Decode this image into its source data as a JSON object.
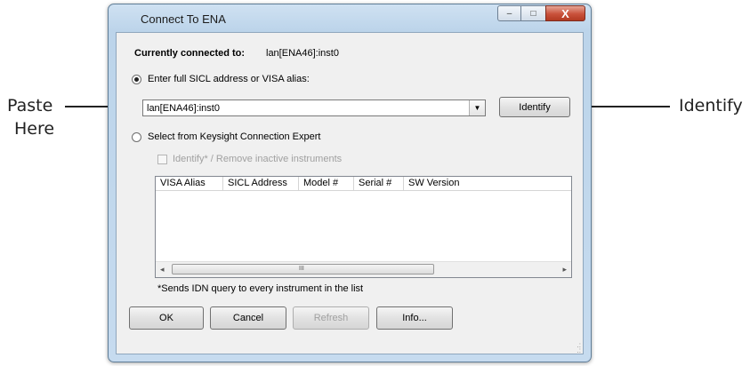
{
  "callouts": {
    "left_line1": "Paste",
    "left_line2": "Here",
    "right": "Identify"
  },
  "window": {
    "title": "Connect To ENA",
    "controls": {
      "minimize": "–",
      "maximize": "□",
      "close": "X"
    }
  },
  "dialog": {
    "connected_label": "Currently connected to:",
    "connected_value": "lan[ENA46]:inst0",
    "option_sicl_label": "Enter full SICL address or VISA alias:",
    "address_value": "lan[ENA46]:inst0",
    "identify_button": "Identify",
    "option_expert_label": "Select from Keysight Connection Expert",
    "identify_remove_label": "Identify* / Remove inactive instruments",
    "table_columns": [
      "VISA Alias",
      "SICL Address",
      "Model #",
      "Serial #",
      "SW Version"
    ],
    "scroll_grip": "III",
    "footnote": "*Sends IDN query to every instrument in the list",
    "buttons": {
      "ok": "OK",
      "cancel": "Cancel",
      "refresh": "Refresh",
      "info": "Info..."
    }
  },
  "colors": {
    "frame": "#c6dbef",
    "client": "#f0f0f0",
    "close": "#c9513b",
    "disabled_text": "#a0a0a0"
  }
}
